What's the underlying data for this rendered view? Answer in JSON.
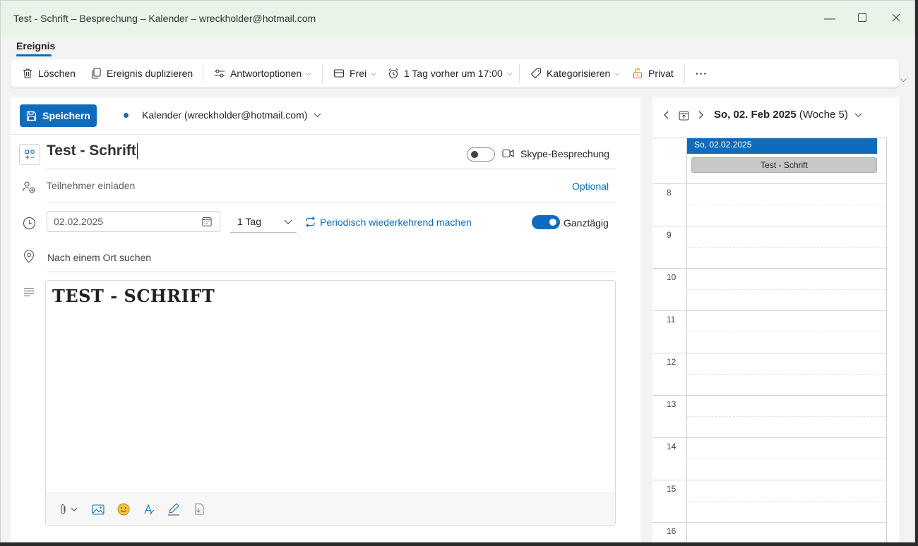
{
  "window": {
    "title": "Test - Schrift – Besprechung – Kalender – wreckholder@hotmail.com"
  },
  "tabs": [
    {
      "label": "Ereignis",
      "active": true
    }
  ],
  "toolbar": {
    "delete": "Löschen",
    "duplicate": "Ereignis duplizieren",
    "response_options": "Antwortoptionen",
    "show_as": "Frei",
    "reminder": "1 Tag vorher um 17:00",
    "categorize": "Kategorisieren",
    "private": "Privat",
    "more": "···"
  },
  "form": {
    "save": "Speichern",
    "calendar": "Kalender (wreckholder@hotmail.com)",
    "event_title": "Test - Schrift",
    "skype_label": "Skype-Besprechung",
    "skype_on": false,
    "attendees_placeholder": "Teilnehmer einladen",
    "optional": "Optional",
    "date": "02.02.2025",
    "duration": "1 Tag",
    "recurrence": "Periodisch wiederkehrend machen",
    "all_day_label": "Ganztägig",
    "all_day_on": true,
    "location_placeholder": "Nach einem Ort suchen",
    "body_text": "TEST - SCHRIFT"
  },
  "sidebar": {
    "date_bold": "So, 02. Feb 2025",
    "week": "(Woche 5)",
    "day_header": "So, 02.02.2025",
    "allday_event": "Test - Schrift",
    "hours": [
      "8",
      "9",
      "10",
      "11",
      "12",
      "13",
      "14",
      "15",
      "16"
    ]
  },
  "colors": {
    "accent": "#0f6cbd",
    "titlebar": "#e9f4e8"
  }
}
